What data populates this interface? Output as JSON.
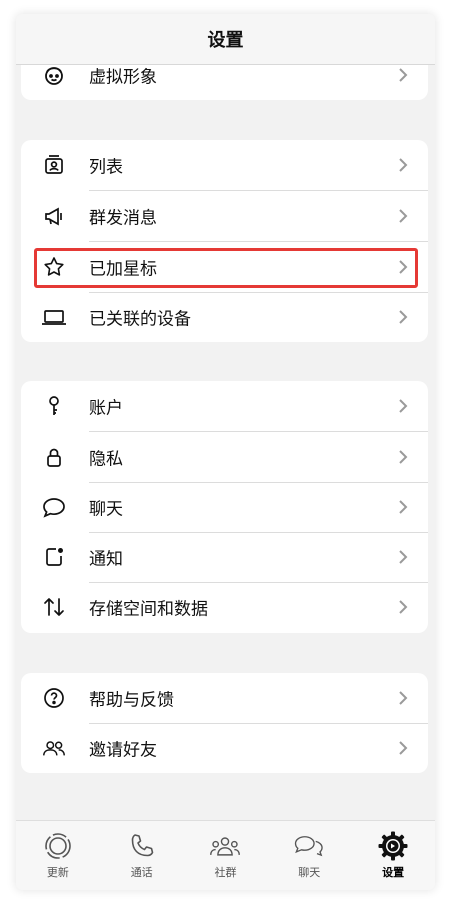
{
  "header": {
    "title": "设置"
  },
  "groups": {
    "top": {
      "items": [
        {
          "label": "虚拟形象",
          "icon": "avatar-face-icon"
        }
      ]
    },
    "lists": {
      "items": [
        {
          "label": "列表",
          "icon": "contact-card-icon"
        },
        {
          "label": "群发消息",
          "icon": "megaphone-icon"
        },
        {
          "label": "已加星标",
          "icon": "star-icon"
        },
        {
          "label": "已关联的设备",
          "icon": "laptop-icon"
        }
      ]
    },
    "account": {
      "items": [
        {
          "label": "账户",
          "icon": "key-icon"
        },
        {
          "label": "隐私",
          "icon": "lock-icon"
        },
        {
          "label": "聊天",
          "icon": "chat-bubble-icon"
        },
        {
          "label": "通知",
          "icon": "notification-icon"
        },
        {
          "label": "存储空间和数据",
          "icon": "up-down-arrows-icon"
        }
      ]
    },
    "help": {
      "items": [
        {
          "label": "帮助与反馈",
          "icon": "question-circle-icon"
        },
        {
          "label": "邀请好友",
          "icon": "people-icon"
        }
      ]
    }
  },
  "highlight": {
    "label": "已加星标",
    "color": "#e53935"
  },
  "tabbar": {
    "active": "设置",
    "tabs": [
      {
        "label": "更新",
        "icon": "status-updates-icon"
      },
      {
        "label": "通话",
        "icon": "phone-icon"
      },
      {
        "label": "社群",
        "icon": "communities-icon"
      },
      {
        "label": "聊天",
        "icon": "chats-icon"
      },
      {
        "label": "设置",
        "icon": "settings-gear-icon"
      }
    ]
  }
}
